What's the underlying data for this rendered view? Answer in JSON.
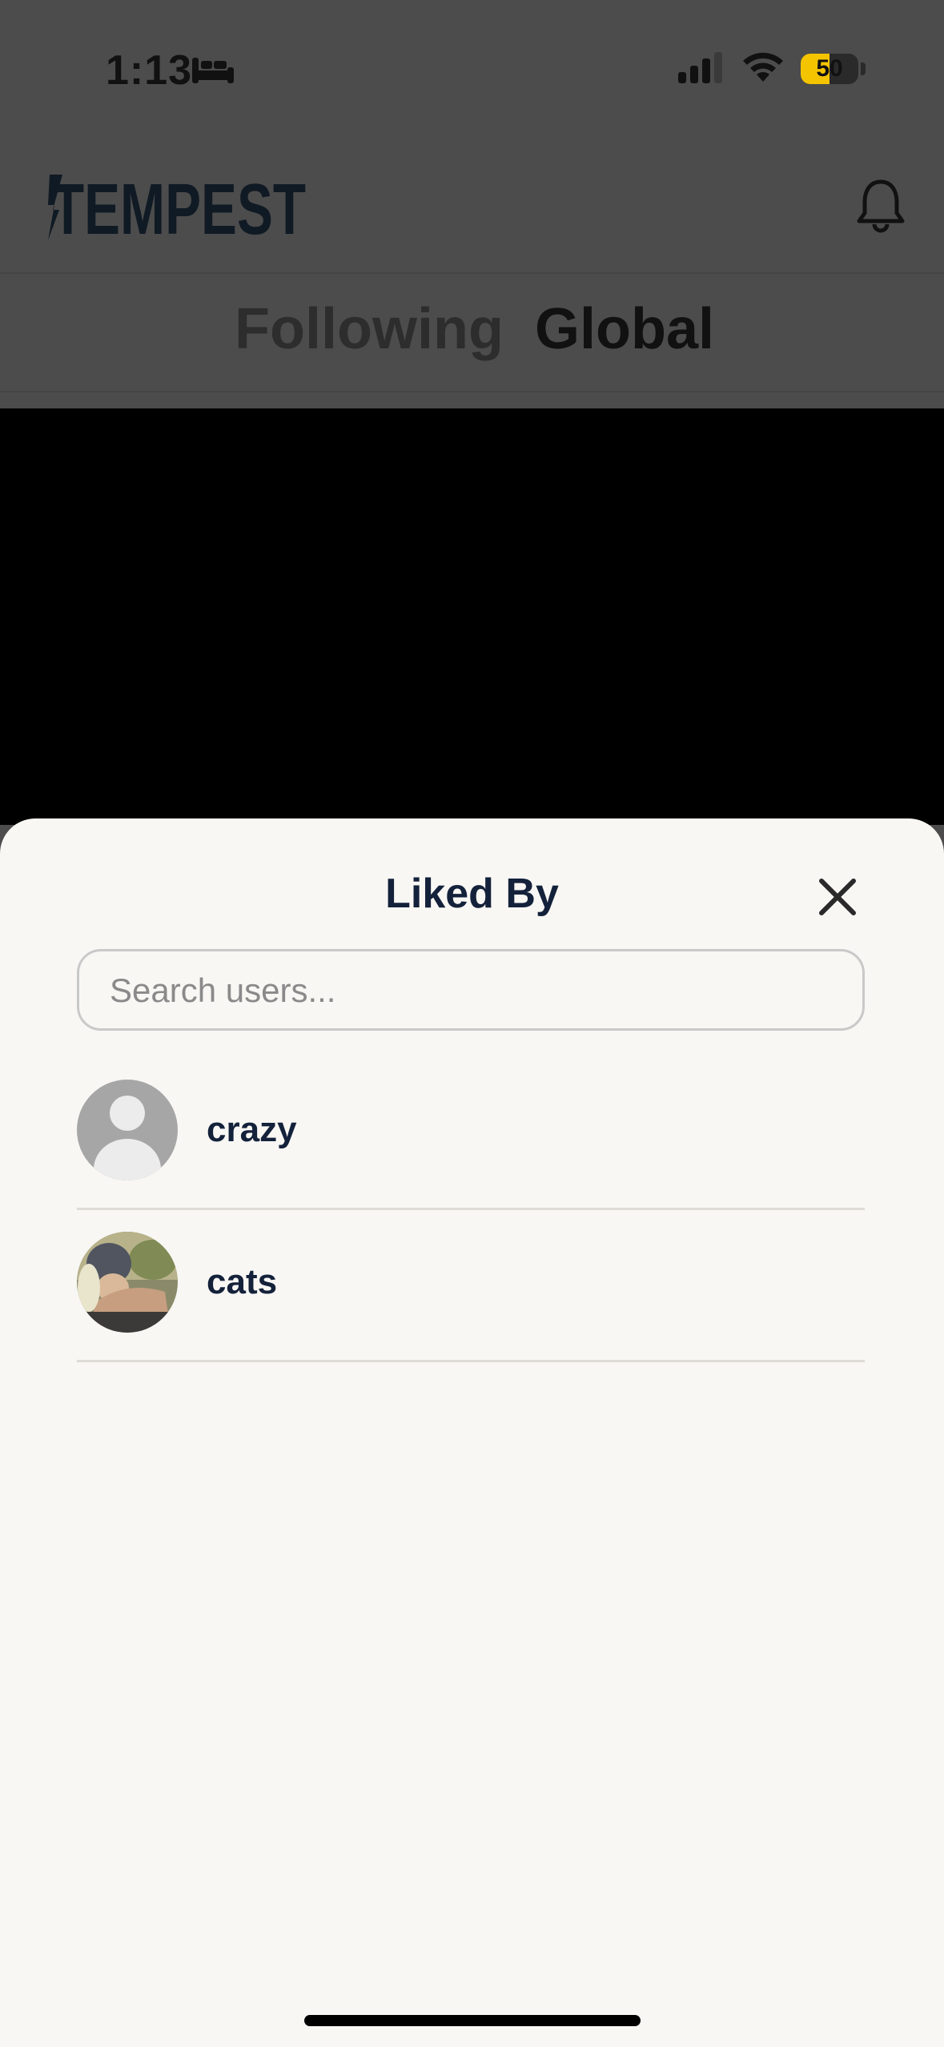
{
  "status_bar": {
    "time": "1:13",
    "focus_icon": "bed-icon",
    "battery_level": 50,
    "battery_text": "50",
    "battery_color": "#f5c400"
  },
  "header": {
    "logo_text": "TEMPEST",
    "notification_icon": "bell-icon"
  },
  "feed_tabs": [
    {
      "label": "Following",
      "active": false
    },
    {
      "label": "Global",
      "active": true
    }
  ],
  "sheet": {
    "title": "Liked By",
    "close_icon": "close-icon",
    "search_placeholder": "Search users...",
    "users": [
      {
        "username": "crazy",
        "avatar": "default-avatar-icon"
      },
      {
        "username": "cats",
        "avatar": "photo-avatar"
      }
    ]
  },
  "colors": {
    "overlay": "#4c4c4c",
    "sheet_bg": "#f8f7f4",
    "text_dark": "#14213a"
  }
}
